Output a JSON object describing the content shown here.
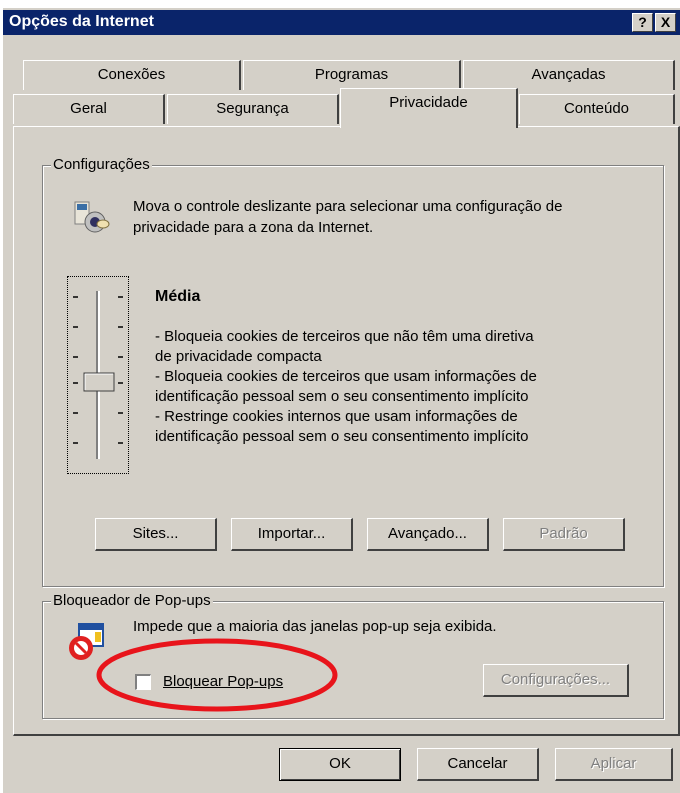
{
  "window": {
    "title": "Opções da Internet",
    "help_label": "?",
    "close_label": "X"
  },
  "tabs": {
    "row1": [
      "Conexões",
      "Programas",
      "Avançadas"
    ],
    "row2": [
      "Geral",
      "Segurança",
      "Privacidade",
      "Conteúdo"
    ],
    "active": "Privacidade"
  },
  "settings": {
    "group_label": "Configurações",
    "intro": "Mova o controle deslizante para selecionar uma configuração de privacidade para a zona da Internet.",
    "level_title": "Média",
    "level_lines": [
      "- Bloqueia cookies de terceiros que não têm uma diretiva",
      "de privacidade compacta",
      "- Bloqueia cookies de terceiros que usam informações de",
      "identificação pessoal sem o seu consentimento implícito",
      "- Restringe cookies internos que usam informações de",
      "identificação pessoal sem o seu consentimento implícito"
    ],
    "buttons": {
      "sites": "Sites...",
      "import": "Importar...",
      "advanced": "Avançado...",
      "default": "Padrão"
    }
  },
  "popup": {
    "group_label": "Bloqueador de Pop-ups",
    "description": "Impede que a maioria das janelas pop-up seja exibida.",
    "checkbox_label": "Bloquear Pop-ups",
    "checkbox_checked": false,
    "settings_button": "Configurações..."
  },
  "footer": {
    "ok": "OK",
    "cancel": "Cancelar",
    "apply": "Aplicar"
  },
  "colors": {
    "titlebar": "#0a246a",
    "face": "#d4d0c8",
    "annotation_ellipse": "#e8141b"
  }
}
